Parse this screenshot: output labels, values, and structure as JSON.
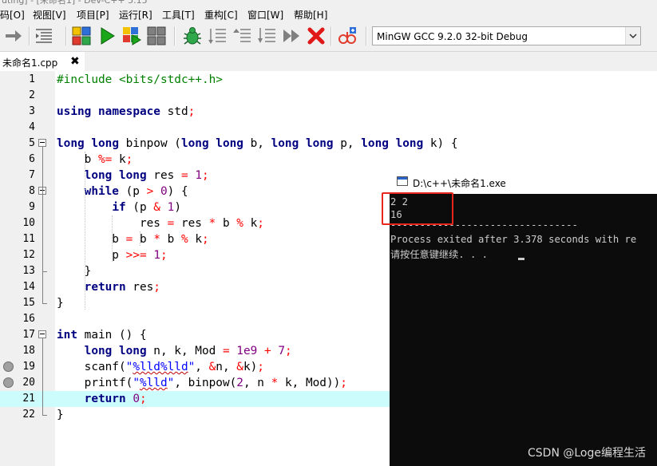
{
  "title_strip": "uting] - [未命名1] - Dev-C++ 5.15",
  "menu": [
    "码[O]",
    "视图[V]",
    "项目[P]",
    "运行[R]",
    "工具[T]",
    "重构[C]",
    "窗口[W]",
    "帮助[H]"
  ],
  "toolbar": {
    "compiler": "MinGW GCC 9.2.0 32-bit Debug",
    "icons": [
      "goto-icon",
      "indent-icon",
      "compile-icon",
      "run-icon",
      "compile-run-icon",
      "rebuild-icon",
      "debug-icon",
      "step-icon",
      "step-over-icon",
      "step-into-icon",
      "continue-icon",
      "stop-icon",
      "profile-icon"
    ]
  },
  "tab": {
    "label": "未命名1.cpp",
    "close": "✖"
  },
  "editor": {
    "line_numbers": [
      "1",
      "2",
      "3",
      "4",
      "5",
      "6",
      "7",
      "8",
      "9",
      "10",
      "11",
      "12",
      "13",
      "14",
      "15",
      "16",
      "17",
      "18",
      "19",
      "20",
      "21",
      "22"
    ],
    "active_line": 21,
    "breakpoint_lines": [
      19,
      20
    ],
    "code_lines": [
      "#include <bits/stdc++.h>",
      "",
      "using namespace std;",
      "",
      "long long binpow (long long b, long long p, long long k) {",
      "    b %= k;",
      "    long long res = 1;",
      "    while (p > 0) {",
      "        if (p & 1)",
      "            res = res * b % k;",
      "        b = b * b % k;",
      "        p >>= 1;",
      "    }",
      "    return res;",
      "}",
      "",
      "int main () {",
      "    long long n, k, Mod = 1e9 + 7;",
      "    scanf(\"%lld%lld\", &n, &k);",
      "    printf(\"%lld\", binpow(2, n * k, Mod));",
      "    return 0;",
      "}"
    ]
  },
  "console": {
    "title": "D:\\c++\\未命名1.exe",
    "lines": [
      "2 2",
      "16",
      "--------------------------------",
      "Process exited after 3.378 seconds with re",
      "请按任意键继续. . . "
    ]
  },
  "watermark": "CSDN @Loge编程生活",
  "colors": {
    "keyword": "#000080",
    "number": "#800080",
    "operator": "#ff0000",
    "string": "#0000ff",
    "active_line": "#ccfcfc",
    "highlight": "#e8261e"
  }
}
